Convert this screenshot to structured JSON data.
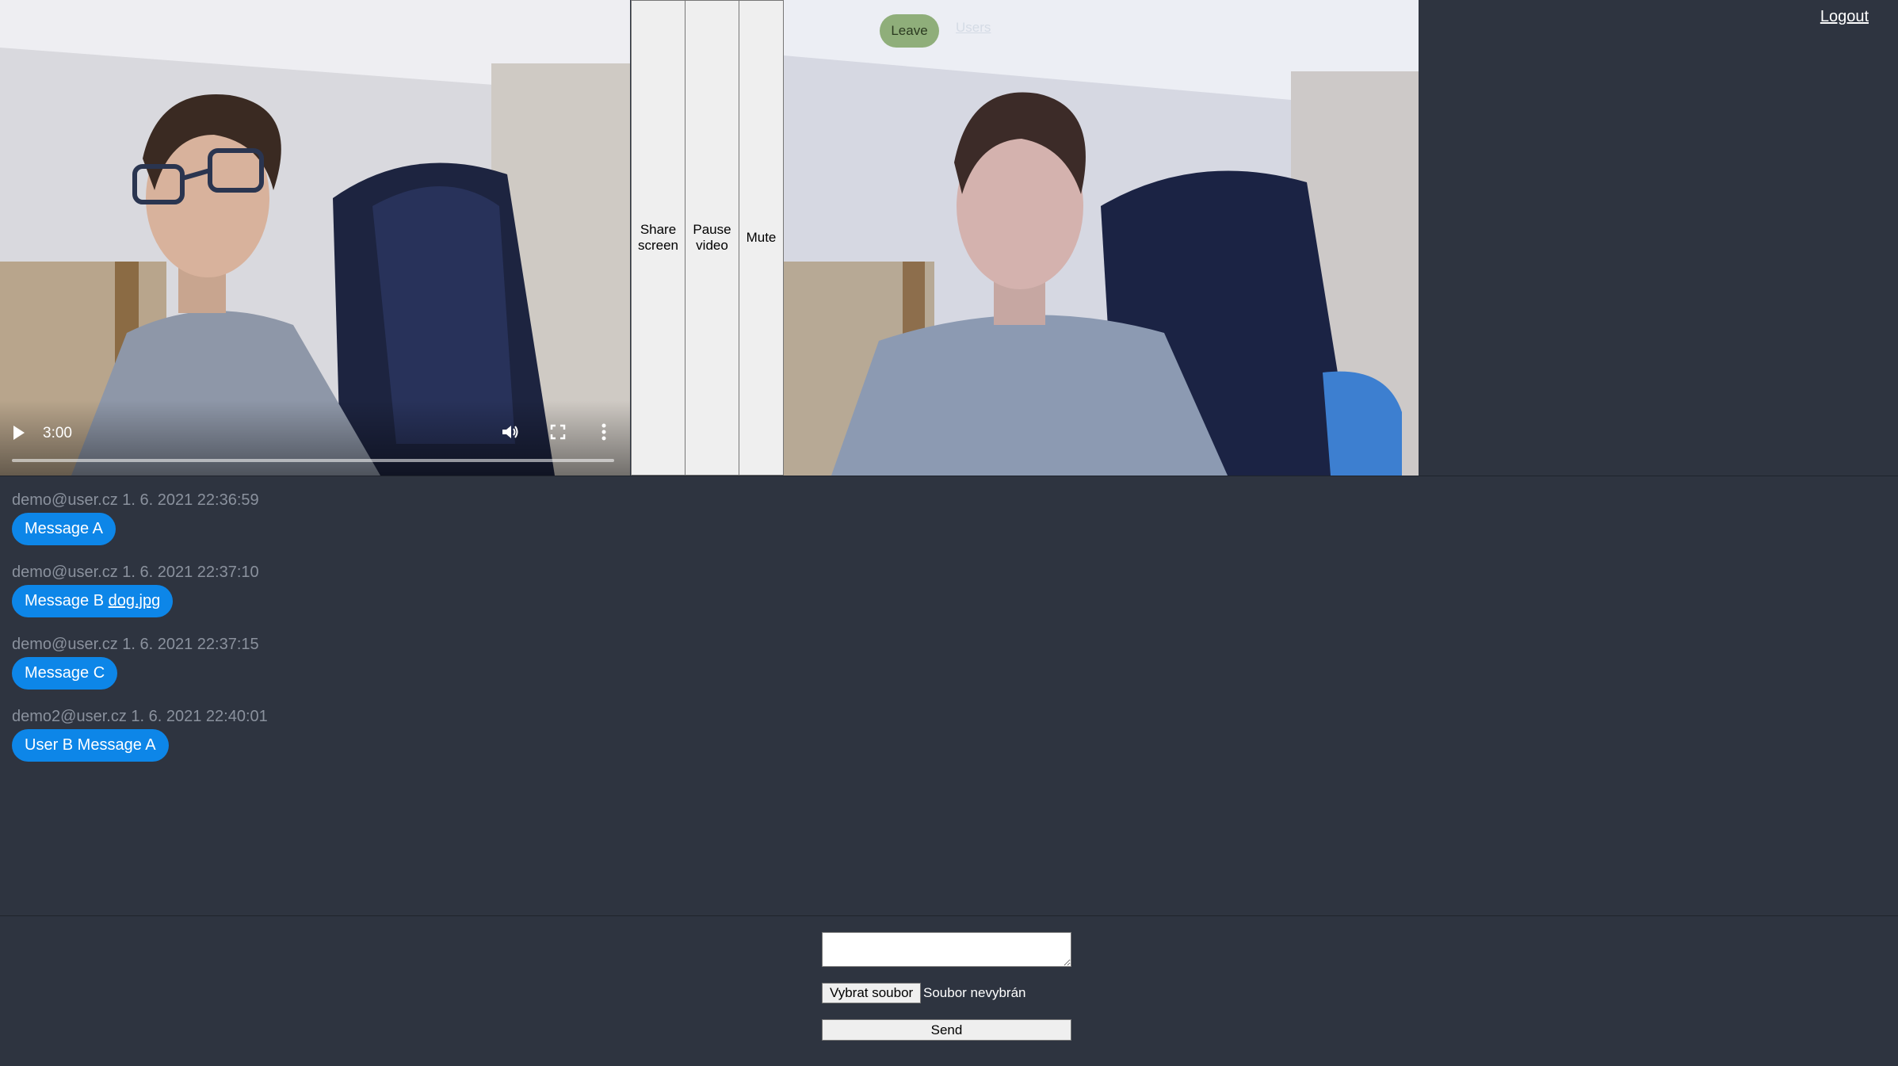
{
  "local_video": {
    "time": "3:00",
    "icons": [
      "play-icon",
      "volume-icon",
      "fullscreen-icon",
      "more-options-icon"
    ]
  },
  "controls": {
    "share_screen": "Share screen",
    "pause_video": "Pause video",
    "mute": "Mute"
  },
  "remote_overlay": {
    "leave": "Leave",
    "users": "Users"
  },
  "header": {
    "logout": "Logout"
  },
  "messages": [
    {
      "sender": "demo@user.cz",
      "timestamp": "1. 6. 2021 22:36:59",
      "text": "Message A",
      "attachment": ""
    },
    {
      "sender": "demo@user.cz",
      "timestamp": "1. 6. 2021 22:37:10",
      "text": "Message B",
      "attachment": "dog.jpg"
    },
    {
      "sender": "demo@user.cz",
      "timestamp": "1. 6. 2021 22:37:15",
      "text": "Message C",
      "attachment": ""
    },
    {
      "sender": "demo2@user.cz",
      "timestamp": "1. 6. 2021 22:40:01",
      "text": "User B Message A",
      "attachment": ""
    }
  ],
  "composer": {
    "message_value": "",
    "choose_file": "Vybrat soubor",
    "file_status": "Soubor nevybrán",
    "send": "Send"
  },
  "colors": {
    "background": "#2e3440",
    "bubble": "#0d86e8",
    "leave_button": "#8fae7a",
    "meta_text": "#8a919d"
  }
}
